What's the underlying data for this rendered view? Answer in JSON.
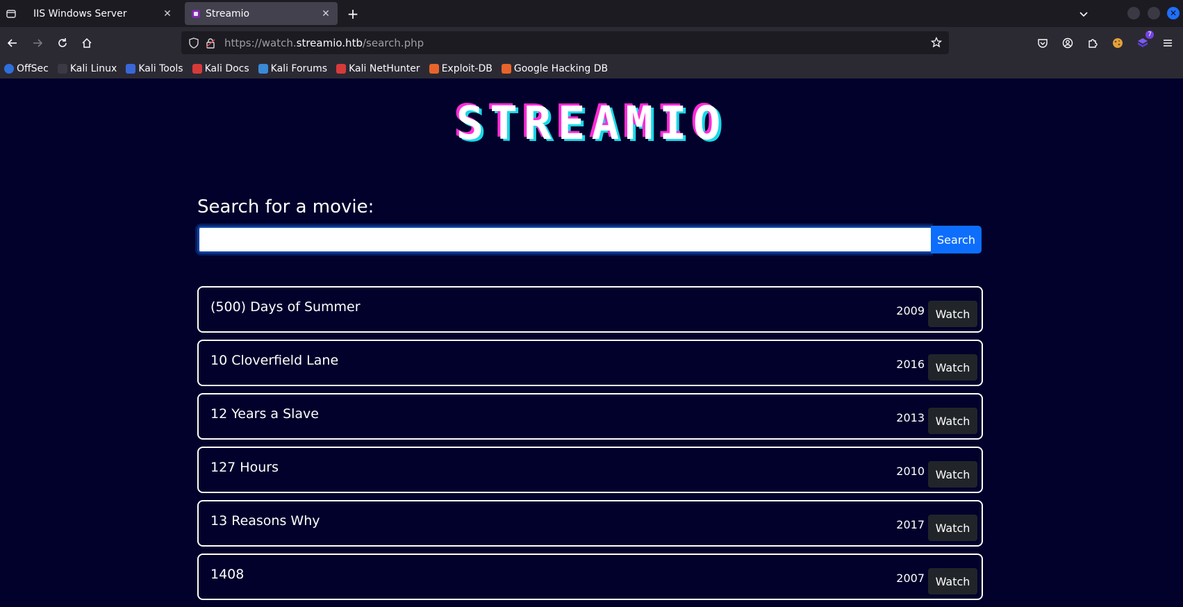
{
  "browser": {
    "tabs": [
      {
        "title": "IIS Windows Server",
        "active": false
      },
      {
        "title": "Streamio",
        "active": true
      }
    ],
    "url": {
      "prefix": "https://watch.",
      "host": "streamio.htb",
      "path": "/search.php"
    },
    "extensions_badge": "7",
    "bookmarks": [
      {
        "label": "OffSec",
        "color": "#2f6fdc"
      },
      {
        "label": "Kali Linux",
        "color": "#2b2a33"
      },
      {
        "label": "Kali Tools",
        "color": "#3a67d8"
      },
      {
        "label": "Kali Docs",
        "color": "#d83a3a"
      },
      {
        "label": "Kali Forums",
        "color": "#3a8ad8"
      },
      {
        "label": "Kali NetHunter",
        "color": "#d83a3a"
      },
      {
        "label": "Exploit-DB",
        "color": "#e8642a"
      },
      {
        "label": "Google Hacking DB",
        "color": "#e8642a"
      }
    ]
  },
  "page": {
    "logo": "STREAMIO",
    "search": {
      "heading": "Search for a movie:",
      "value": "",
      "button": "Search"
    },
    "movies": [
      {
        "title": "(500) Days of Summer",
        "year": "2009",
        "action": "Watch"
      },
      {
        "title": "10 Cloverfield Lane",
        "year": "2016",
        "action": "Watch"
      },
      {
        "title": "12 Years a Slave",
        "year": "2013",
        "action": "Watch"
      },
      {
        "title": "127 Hours",
        "year": "2010",
        "action": "Watch"
      },
      {
        "title": "13 Reasons Why",
        "year": "2017",
        "action": "Watch"
      },
      {
        "title": "1408",
        "year": "2007",
        "action": "Watch"
      }
    ]
  }
}
